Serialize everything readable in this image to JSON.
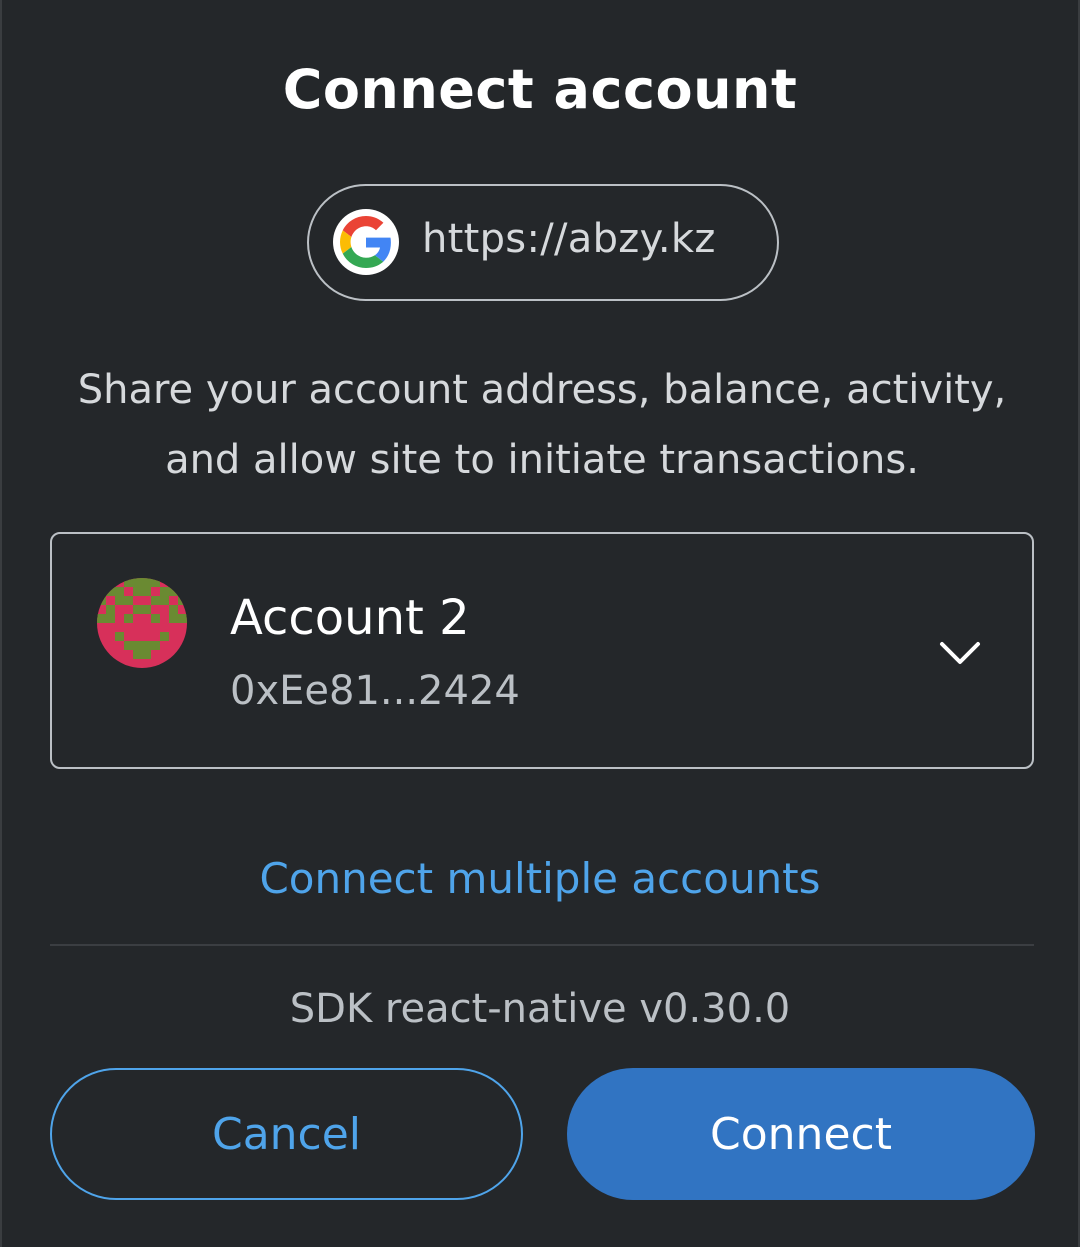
{
  "dialog": {
    "title": "Connect account"
  },
  "site": {
    "icon": "google-g-icon",
    "url": "https://abzy.kz"
  },
  "description": {
    "line1": "Share your account address, balance, activity,",
    "line2": "and allow site to initiate transactions."
  },
  "account": {
    "avatar": "identicon",
    "name": "Account 2",
    "address": "0xEe81...2424",
    "expand_icon": "chevron-down-icon"
  },
  "links": {
    "connect_multiple": "Connect multiple accounts"
  },
  "footer": {
    "sdk_version": "SDK react-native v0.30.0"
  },
  "actions": {
    "cancel_label": "Cancel",
    "connect_label": "Connect"
  },
  "colors": {
    "background": "#24272a",
    "primary": "#3174c2",
    "link": "#4fa4ea",
    "avatar_primary": "#d7305a",
    "avatar_secondary": "#6a8a32"
  }
}
